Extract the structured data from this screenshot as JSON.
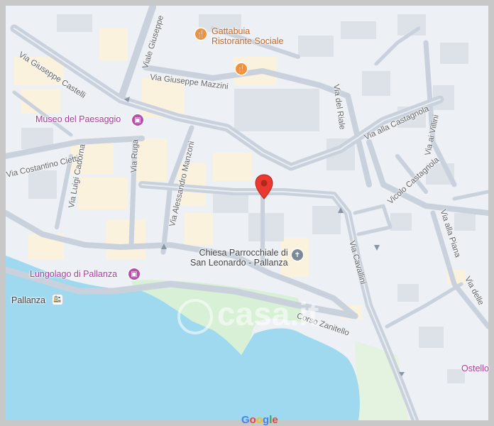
{
  "map": {
    "streets": {
      "giuseppe_castelli": "Via Giuseppe Castelli",
      "viale_giuseppe": "Viale Giuseppe",
      "giuseppe_mazzini": "Via Giuseppe Mazzini",
      "del_riale": "Via del Riale",
      "alla_castagnola": "Via alla Castagnola",
      "ai_villini": "Via ai Villini",
      "vicolo_castagnola": "Vicolo Castagnola",
      "costantino_cietti": "Via Costantino Cietti",
      "luigi_cadorna": "Via Luigi Cadorna",
      "ruga": "Via Ruga",
      "alessandro_manzoni": "Via Alessandro Manzoni",
      "cavallini": "Via Cavallini",
      "alla_piana": "Via alla Piana",
      "delle": "Via delle",
      "corso_zanitello": "Corso Zanitello"
    },
    "places": {
      "gattabuia_line1": "Gattabuia",
      "gattabuia_line2": "Ristorante Sociale",
      "museo": "Museo del Paesaggio",
      "chiesa_line1": "Chiesa Parrocchiale di",
      "chiesa_line2": "San Leonardo - Pallanza",
      "lungolago": "Lungolago di Pallanza",
      "pallanza": "Pallanza",
      "ostello": "Ostello"
    },
    "icons": {
      "restaurant": "restaurant-icon",
      "museum": "camera-icon",
      "church": "church-icon",
      "transit": "train-station-icon",
      "pin": "location-pin-icon"
    },
    "watermark": "casa.it",
    "logo": "Google",
    "colors": {
      "water": "#9fd9ef",
      "land": "#edf0f4",
      "road": "#c9d1dc",
      "park": "#d8f0d6",
      "building_tan": "#fbf2dd",
      "pin": "#ea3a2f"
    }
  }
}
